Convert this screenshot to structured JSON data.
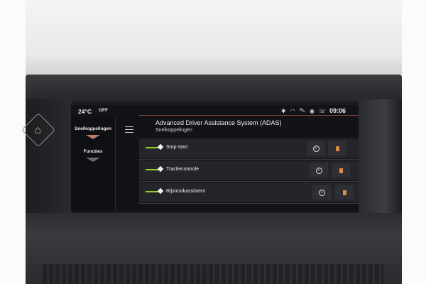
{
  "status": {
    "temperature": "24°C",
    "ac_mode": "OFF",
    "clock": "09:06",
    "icons": [
      "bluetooth-icon",
      "wifi-icon",
      "car-icon",
      "location-pin-icon",
      "phone-icon"
    ]
  },
  "sidebar": {
    "items": [
      {
        "label": "Snelkoppelingen",
        "active": true
      },
      {
        "label": "Functies",
        "active": false
      }
    ]
  },
  "header": {
    "title": "Advanced Driver Assistance System (ADAS)",
    "subtitle": "Snelkoppelingen"
  },
  "shortcuts": [
    {
      "label": "Stop-start",
      "enabled": true
    },
    {
      "label": "Tractiecontrole",
      "enabled": true
    },
    {
      "label": "Rijstrookassistent",
      "enabled": true
    }
  ],
  "colors": {
    "accent": "#b8806a",
    "toggle_on": "#9acd32",
    "bookmark": "#d98a4a"
  }
}
